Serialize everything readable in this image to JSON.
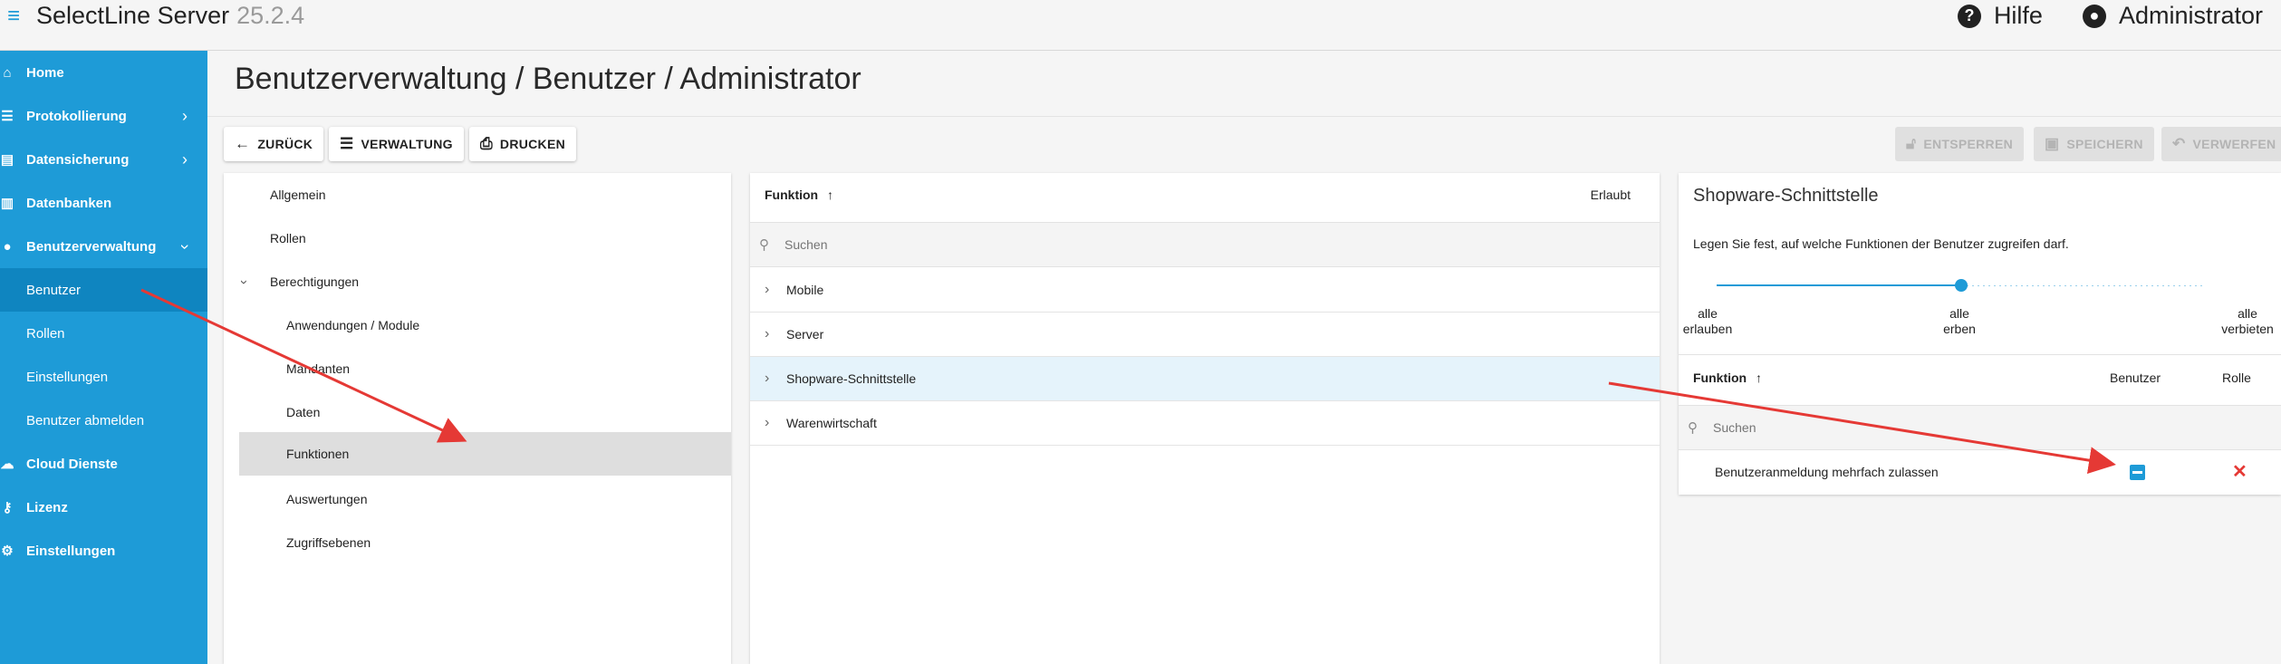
{
  "app": {
    "title": "SelectLine Server",
    "version": "25.2.4"
  },
  "header": {
    "help_label": "Hilfe",
    "user_label": "Administrator"
  },
  "sidebar": {
    "items": [
      {
        "label": "Home",
        "icon": "home-icon"
      },
      {
        "label": "Protokollierung",
        "icon": "list-icon"
      },
      {
        "label": "Datensicherung",
        "icon": "backup-icon"
      },
      {
        "label": "Datenbanken",
        "icon": "database-icon"
      },
      {
        "label": "Benutzerverwaltung",
        "icon": "user-icon"
      },
      {
        "label": "Benutzer"
      },
      {
        "label": "Rollen"
      },
      {
        "label": "Einstellungen"
      },
      {
        "label": "Benutzer abmelden"
      },
      {
        "label": "Cloud Dienste",
        "icon": "cloud-icon"
      },
      {
        "label": "Lizenz",
        "icon": "key-icon"
      },
      {
        "label": "Einstellungen",
        "icon": "gear-icon"
      }
    ]
  },
  "page": {
    "title": "Benutzerverwaltung / Benutzer / Administrator"
  },
  "toolbar": {
    "back": "ZURÜCK",
    "manage": "VERWALTUNG",
    "print": "DRUCKEN",
    "unlock": "ENTSPERREN",
    "save": "SPEICHERN",
    "discard": "VERWERFEN"
  },
  "tree": {
    "items": [
      "Allgemein",
      "Rollen",
      "Berechtigungen",
      "Anwendungen / Module",
      "Mandanten",
      "Daten",
      "Funktionen",
      "Auswertungen",
      "Zugriffsebenen"
    ],
    "selected": "Funktionen"
  },
  "middle": {
    "col_function": "Funktion",
    "sort_indicator": "↑",
    "col_allowed": "Erlaubt",
    "search_placeholder": "Suchen",
    "rows": [
      "Mobile",
      "Server",
      "Shopware-Schnittstelle",
      "Warenwirtschaft"
    ],
    "selected": "Shopware-Schnittstelle"
  },
  "detail": {
    "title": "Shopware-Schnittstelle",
    "description": "Legen Sie fest, auf welche Funktionen der Benutzer zugreifen darf.",
    "slider": {
      "labels": [
        {
          "l1": "alle",
          "l2": "erlauben"
        },
        {
          "l1": "alle",
          "l2": "erben"
        },
        {
          "l1": "alle",
          "l2": "verbieten"
        }
      ],
      "value": "alle erben"
    },
    "col_function": "Funktion",
    "sort_indicator": "↑",
    "col_user": "Benutzer",
    "col_role": "Rolle",
    "search_placeholder": "Suchen",
    "rows": [
      {
        "label": "Benutzeranmeldung mehrfach zulassen",
        "user_state": "indeterminate",
        "role_state": "denied"
      }
    ]
  },
  "colors": {
    "accent": "#1e9bd7",
    "arrow": "#e53935",
    "sidebar_active": "#0f85c0"
  }
}
